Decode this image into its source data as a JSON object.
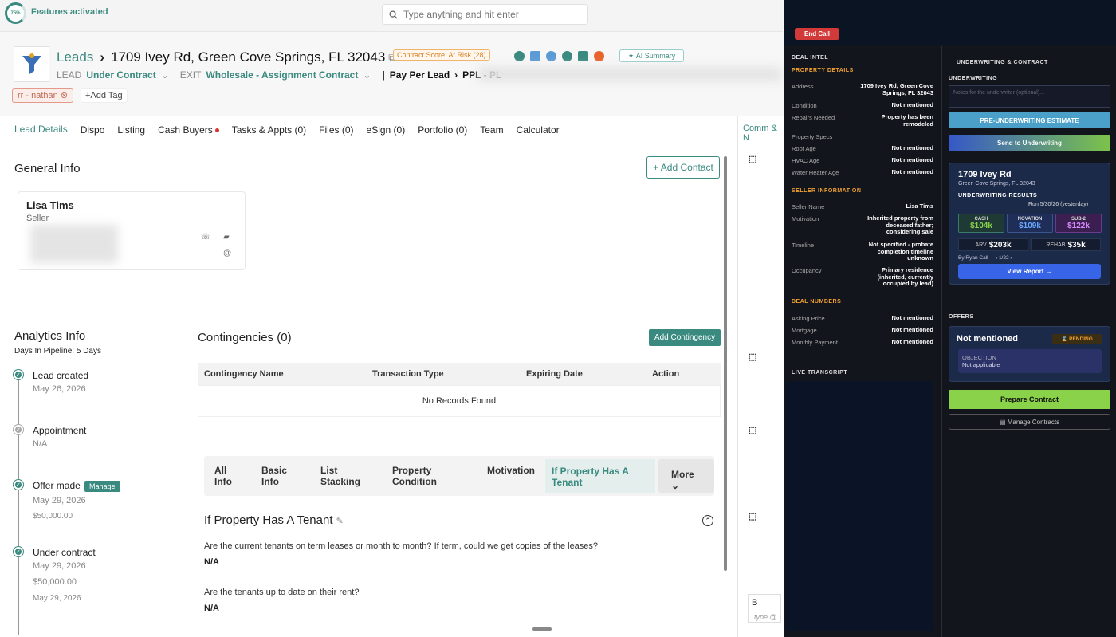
{
  "topbar": {
    "progress": "75%",
    "features": "Features activated",
    "search_placeholder": "Type anything and hit enter"
  },
  "header": {
    "crumb_root": "Leads",
    "address": "1709 Ivey Rd, Green Cove Springs, FL 32043",
    "contract_score": "Contract Score: At Risk (28)",
    "ai_summary": "AI Summary",
    "lead_label": "LEAD",
    "lead_status": "Under Contract",
    "exit_label": "EXIT",
    "exit_strategy": "Wholesale - Assignment Contract",
    "source": "Pay Per Lead",
    "source_sub": "PPL - PL",
    "tag": "rr - nathan",
    "add_tag": "+Add Tag"
  },
  "tabs": [
    "Lead Details",
    "Dispo",
    "Listing",
    "Cash Buyers",
    "Tasks & Appts (0)",
    "Files (0)",
    "eSign (0)",
    "Portfolio (0)",
    "Team",
    "Calculator"
  ],
  "general": {
    "title": "General Info",
    "add_contact": "+ Add Contact",
    "contact_name": "Lisa Tims",
    "contact_role": "Seller"
  },
  "analytics": {
    "title": "Analytics Info",
    "days": "Days In Pipeline: 5 Days",
    "events": [
      {
        "title": "Lead created",
        "sub": [
          "May 26, 2026"
        ]
      },
      {
        "title": "Appointment",
        "sub": [
          "N/A"
        ]
      },
      {
        "title": "Offer made",
        "badge": "Manage",
        "sub": [
          "May 29, 2026",
          "$50,000.00"
        ]
      },
      {
        "title": "Under contract",
        "sub": [
          "May 29, 2026",
          "$50,000.00",
          "May 29, 2026"
        ]
      }
    ]
  },
  "contingencies": {
    "title": "Contingencies (0)",
    "add": "Add Contingency",
    "cols": [
      "Contingency Name",
      "Transaction Type",
      "Expiring Date",
      "Action"
    ],
    "empty": "No Records Found"
  },
  "subtabs": [
    "All Info",
    "Basic Info",
    "List Stacking",
    "Property Condition",
    "Motivation",
    "If Property Has A Tenant",
    "More"
  ],
  "tenant": {
    "title": "If Property Has A Tenant",
    "q1": "Are the current tenants on term leases or month to month? If term, could we get copies of the leases?",
    "a1": "N/A",
    "q2": "Are the tenants up to date on their rent?",
    "a2": "N/A"
  },
  "comm": {
    "tab": "Comm & N",
    "editor_placeholder": "type @"
  },
  "panel": {
    "end_call": "End Call",
    "deal_intel": "DEAL INTEL",
    "property_details": "PROPERTY DETAILS",
    "property": [
      {
        "k": "Address",
        "v": "1709 Ivey Rd, Green Cove Springs, FL 32043"
      },
      {
        "k": "Condition",
        "v": "Not mentioned"
      },
      {
        "k": "Repairs Needed",
        "v": "Property has been remodeled"
      },
      {
        "k": "Property Specs",
        "v": ""
      },
      {
        "k": "Roof Age",
        "v": "Not mentioned"
      },
      {
        "k": "HVAC Age",
        "v": "Not mentioned"
      },
      {
        "k": "Water Heater Age",
        "v": "Not mentioned"
      }
    ],
    "seller_info": "SELLER INFORMATION",
    "seller": [
      {
        "k": "Seller Name",
        "v": "Lisa Tims"
      },
      {
        "k": "Motivation",
        "v": "Inherited property from deceased father; considering sale"
      },
      {
        "k": "Timeline",
        "v": "Not specified - probate completion timeline unknown"
      },
      {
        "k": "Occupancy",
        "v": "Primary residence (inherited, currently occupied by lead)"
      }
    ],
    "deal_numbers": "DEAL NUMBERS",
    "numbers": [
      {
        "k": "Asking Price",
        "v": "Not mentioned"
      },
      {
        "k": "Mortgage",
        "v": "Not mentioned"
      },
      {
        "k": "Monthly Payment",
        "v": "Not mentioned"
      }
    ],
    "live_transcript": "LIVE TRANSCRIPT",
    "uw_contract": "UNDERWRITING & CONTRACT",
    "underwriting": "UNDERWRITING",
    "notes_placeholder": "Notes for the underwriter (optional)...",
    "pre_uw": "PRE-UNDERWRITING ESTIMATE",
    "send_uw": "Send to Underwriting",
    "uw_title": "1709 Ivey Rd",
    "uw_sub": "Green Cove Springs, FL 32043",
    "uw_results": "UNDERWRITING RESULTS",
    "uw_run": "Run 5/30/26 (yesterday)",
    "cash_label": "CASH",
    "cash": "$104k",
    "novation_label": "NOVATION",
    "novation": "$109k",
    "sub2_label": "SUB-2",
    "sub2": "$122k",
    "arv_label": "ARV",
    "arv": "$203k",
    "rehab_label": "REHAB",
    "rehab": "$35k",
    "by": "By Ryan Call ·",
    "pager": "1/22",
    "view_report": "View Report →",
    "offers": "OFFERS",
    "offer_status": "Not mentioned",
    "pending": "PENDING",
    "objection_label": "OBJECTION",
    "objection": "Not applicable",
    "prepare": "Prepare Contract",
    "manage_contracts": "Manage Contracts"
  },
  "colors": {
    "accent": "#3a8a80",
    "panel": "#13151c",
    "danger": "#d23a3a"
  }
}
